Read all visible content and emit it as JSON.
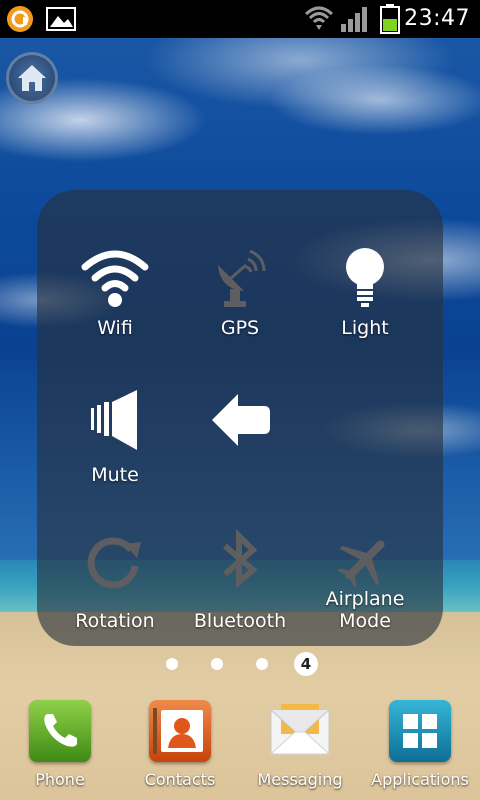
{
  "status_bar": {
    "time": "23:47",
    "icons": [
      "notification-app-icon",
      "image-notification-icon",
      "wifi-icon",
      "signal-icon",
      "battery-icon"
    ]
  },
  "home_shortcut": {
    "icon": "home-icon"
  },
  "panel": {
    "tiles": [
      {
        "label": "Wifi",
        "icon": "wifi-icon",
        "state": "on"
      },
      {
        "label": "GPS",
        "icon": "gps-dish-icon",
        "state": "off"
      },
      {
        "label": "Light",
        "icon": "lightbulb-icon",
        "state": "on"
      },
      {
        "label": "Mute",
        "icon": "speaker-mute-icon",
        "state": "on"
      },
      {
        "label": "",
        "icon": "back-arrow-icon",
        "state": "on"
      },
      {
        "label": "Rotation",
        "icon": "rotation-icon",
        "state": "off"
      },
      {
        "label": "Bluetooth",
        "icon": "bluetooth-icon",
        "state": "off"
      },
      {
        "label": "Airplane\nMode",
        "icon": "airplane-icon",
        "state": "off"
      }
    ]
  },
  "pager": {
    "current_page": "4",
    "total_dots": 4
  },
  "dock": [
    {
      "label": "Phone",
      "icon": "phone-icon",
      "color": "#4a9a1e"
    },
    {
      "label": "Contacts",
      "icon": "contacts-icon",
      "color": "#e0571c"
    },
    {
      "label": "Messaging",
      "icon": "envelope-icon",
      "color": "#f0b43a"
    },
    {
      "label": "Applications",
      "icon": "apps-grid-icon",
      "color": "#1a8db0"
    }
  ]
}
